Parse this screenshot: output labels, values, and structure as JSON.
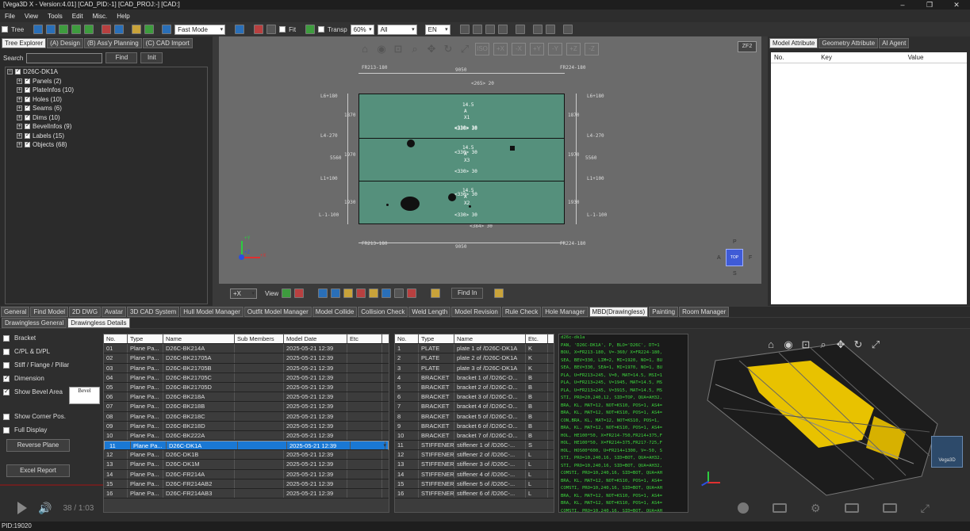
{
  "title_bar": {
    "text": "[Vega3D X - Version:4.01] [CAD_PID:-1] [CAD_PROJ:-] [CAD:]",
    "minimize": "–",
    "maximize": "❐",
    "close": "✕"
  },
  "menu": [
    "File",
    "View",
    "Tools",
    "Edit",
    "Misc.",
    "Help"
  ],
  "toolbar": {
    "tree_label": "Tree",
    "mode": "Fast Mode",
    "fit_label": "Fit",
    "transp_label": "Transp",
    "transp_value": "60%",
    "filter_value": "All",
    "lang_value": "EN"
  },
  "left_panel": {
    "tabs": [
      "Tree Explorer",
      "(A) Design",
      "(B) Ass'y Planning",
      "(C) CAD Import"
    ],
    "search_label": "Search",
    "find_button": "Find",
    "init_button": "Init",
    "root": "D26C-DK1A",
    "items": [
      "Panels (2)",
      "PlateInfos (10)",
      "Holes (10)",
      "Seams (6)",
      "Dims (10)",
      "BevelInfos (9)",
      "Labels (15)",
      "Objects (68)"
    ]
  },
  "viewport": {
    "ff_label": "ZF2",
    "view_buttons": [
      "ISO",
      "+X",
      "-X",
      "+Y",
      "-Y",
      "+Z",
      "-Z"
    ],
    "dims": {
      "top_width": "9050",
      "bottom_width": "9050",
      "left_total": "5560",
      "right_total": "5560",
      "left_upper": "1870",
      "left_middle": "1970",
      "left_lower": "1930",
      "right_upper": "1870",
      "right_middle": "1970",
      "right_lower": "1930",
      "top_inner": "<265> 20",
      "bottom_inner": "<384> 30"
    },
    "frame_labels": {
      "top_left": "FR213-180",
      "top_right": "FR224-180",
      "bottom_left": "FR213-180",
      "bottom_right": "FR224-180",
      "left": [
        "L6+180",
        "L4-270",
        "L1+100",
        "L-1-100"
      ],
      "right": [
        "L6+180",
        "L4-270",
        "L1+100",
        "L-1-100"
      ]
    },
    "plate_labels": [
      {
        "t": "14.5",
        "a": "A",
        "k": "X1",
        "s": "<330> 30"
      },
      {
        "t": "14.5",
        "a": "A",
        "k": "X3",
        "s": "<330> 30"
      },
      {
        "t": "14.5",
        "a": "A",
        "k": "X2",
        "s": "<330> 30"
      }
    ],
    "row_spacing": [
      "<330> 30",
      "<330> 30",
      "<330> 30"
    ],
    "axis": {
      "y": "+Y",
      "x": "+X",
      "z": "+Z"
    },
    "cube": {
      "top": "P",
      "left": "A",
      "right": "F",
      "bottom": "S",
      "face": "TOP"
    },
    "bottom_view_value": "+X",
    "view_label": "View",
    "find_in": "Find In"
  },
  "right_panel": {
    "tabs": [
      "Model Attribute",
      "Geometry Attribute",
      "AI Agent"
    ],
    "columns": [
      "No.",
      "Key",
      "Value"
    ]
  },
  "bottom_tabs": [
    "General",
    "Find Model",
    "2D DWG",
    "Avatar",
    "3D CAD System",
    "Hull Model Manager",
    "Outfit Model Manager",
    "Model Collide",
    "Collision Check",
    "Weld Length",
    "Model Revision",
    "Rule Check",
    "Hole Manager",
    "MBD(Drawingless)",
    "Painting",
    "Room Manager"
  ],
  "sub_tabs": [
    "Drawingless General",
    "Drawingless Details"
  ],
  "options": [
    {
      "label": "Bracket",
      "checked": false
    },
    {
      "label": "C/PL & D/PL",
      "checked": false
    },
    {
      "label": "Stiff / Flange / Pillar",
      "checked": false
    },
    {
      "label": "Dimension",
      "checked": true
    },
    {
      "label": "Show Bevel Area",
      "checked": true
    },
    {
      "label": "Show Corner Pos.",
      "checked": false
    },
    {
      "label": "Full Display",
      "checked": false
    }
  ],
  "bevel_label": "Bevel",
  "reverse_plane": "Reverse Plane",
  "excel_report": "Excel Report",
  "player_time": "38 / 1:03",
  "left_grid": {
    "columns": [
      "No.",
      "Type",
      "Name",
      "Sub Members",
      "Model Date",
      "Etc"
    ],
    "rows": [
      [
        "01",
        "Plane Pa...",
        "D26C-BK214A",
        "",
        "2025-05-21 12:39",
        ""
      ],
      [
        "02",
        "Plane Pa...",
        "D26C-BK21705A",
        "",
        "2025-05-21 12:39",
        ""
      ],
      [
        "03",
        "Plane Pa...",
        "D26C-BK21705B",
        "",
        "2025-05-21 12:39",
        ""
      ],
      [
        "04",
        "Plane Pa...",
        "D26C-BK21705C",
        "",
        "2025-05-21 12:39",
        ""
      ],
      [
        "05",
        "Plane Pa...",
        "D26C-BK21705D",
        "",
        "2025-05-21 12:39",
        ""
      ],
      [
        "06",
        "Plane Pa...",
        "D26C-BK218A",
        "",
        "2025-05-21 12:39",
        ""
      ],
      [
        "07",
        "Plane Pa...",
        "D26C-BK218B",
        "",
        "2025-05-21 12:39",
        ""
      ],
      [
        "08",
        "Plane Pa...",
        "D26C-BK218C",
        "",
        "2025-05-21 12:39",
        ""
      ],
      [
        "09",
        "Plane Pa...",
        "D26C-BK218D",
        "",
        "2025-05-21 12:39",
        ""
      ],
      [
        "10",
        "Plane Pa...",
        "D26C-BK222A",
        "",
        "2025-05-21 12:39",
        ""
      ],
      [
        "11",
        "Plane Pa...",
        "D26C-DK1A",
        "",
        "2025-05-21 12:39",
        ""
      ],
      [
        "12",
        "Plane Pa...",
        "D26C-DK1B",
        "",
        "2025-05-21 12:39",
        ""
      ],
      [
        "13",
        "Plane Pa...",
        "D26C-DK1M",
        "",
        "2025-05-21 12:39",
        ""
      ],
      [
        "14",
        "Plane Pa...",
        "D26C-FR214A",
        "",
        "2025-05-21 12:39",
        ""
      ],
      [
        "15",
        "Plane Pa...",
        "D26C-FR214AB2",
        "",
        "2025-05-21 12:39",
        ""
      ],
      [
        "16",
        "Plane Pa...",
        "D26C-FR214AB3",
        "",
        "2025-05-21 12:39",
        ""
      ]
    ],
    "selected": 10
  },
  "right_grid": {
    "columns": [
      "No.",
      "Type",
      "Name",
      "Etc."
    ],
    "rows": [
      [
        "1",
        "PLATE",
        "plate 1 of /D26C-DK1A",
        "K"
      ],
      [
        "2",
        "PLATE",
        "plate 2 of /D26C-DK1A",
        "K"
      ],
      [
        "3",
        "PLATE",
        "plate 3 of /D26C-DK1A",
        "K"
      ],
      [
        "4",
        "BRACKET",
        "bracket 1 of /D26C-D...",
        "B"
      ],
      [
        "5",
        "BRACKET",
        "bracket 2 of /D26C-D...",
        "B"
      ],
      [
        "6",
        "BRACKET",
        "bracket 3 of /D26C-D...",
        "B"
      ],
      [
        "7",
        "BRACKET",
        "bracket 4 of /D26C-D...",
        "B"
      ],
      [
        "8",
        "BRACKET",
        "bracket 5 of /D26C-D...",
        "B"
      ],
      [
        "9",
        "BRACKET",
        "bracket 6 of /D26C-D...",
        "B"
      ],
      [
        "10",
        "BRACKET",
        "bracket 7 of /D26C-D...",
        "B"
      ],
      [
        "11",
        "STIFFENER",
        "stiffener 1 of /D26C-...",
        "S"
      ],
      [
        "12",
        "STIFFENER",
        "stiffener 2 of /D26C-...",
        "L"
      ],
      [
        "13",
        "STIFFENER",
        "stiffener 3 of /D26C-...",
        "L"
      ],
      [
        "14",
        "STIFFENER",
        "stiffener 4 of /D26C-...",
        "L"
      ],
      [
        "15",
        "STIFFENER",
        "stiffener 5 of /D26C-...",
        "L"
      ],
      [
        "16",
        "STIFFENER",
        "stiffener 6 of /D26C-...",
        "L"
      ]
    ]
  },
  "text_panel": [
    "d26c-dk1a",
    "PAN, 'D26C-DK1A', P, BLO='D26C', DT=1",
    "BOU, X=FR213-180, V=-360/ X=FR224-180,",
    "SEA, BEV=330, LIM=2, MI=1920, NO=1, BU",
    "SEA, BEV=330, SEA=1, MI=1970, NO=1, BU",
    "PLA, U=FR213+245, V=0, MAT=14.5, MSI=1",
    "PLA, U=FR213+245, V=1945, MAT=14.5, MS",
    "PLA, U=FR213+245, V=3915, MAT=14.5, MS",
    "STI, PRO=20,240,12, SID=TOP, QUA=AH32,",
    "BRA, KL, MAT=12, NOT=KS10, POS=1, AS4=",
    "BRA, KL, MAT=12, NOT=KS10, POS=1, AS4=",
    "CON,BRA, KL, MAT=12, NOT=KS10, POS=1,",
    "BRA, KL, MAT=12, NOT=KS10, POS=1, AS4=",
    "HOL, HE100*50, X=FR214-750,FR214+375,F",
    "HOL, HE100*50, X=FR214+375,FR217-725,F",
    "HOL, HOS00*600, U=FR214+1300, V=-50, S",
    "STI, PRO=10,240,16, SID=BOT, QUA=AH32,",
    "STI, PRO=10,240,16, SID=BOT, QUA=AH32,",
    "COMSTI, PRO=10,240,16, SID=BOT, QUA=AH",
    "BRA, KL, MAT=12, NOT=KS10, POS=1, AS4=",
    "COMSTI, PRO=10,240,16, SID=BOT, QUA=AH",
    "BRA, KL, MAT=12, NOT=KS10, POS=1, AS4=",
    "BRA, KL, MAT=12, NOT=KS10, POS=1, AS4=",
    "COMSTI, PRO=10,240,16, SID=BOT, QUA=AH"
  ],
  "preview_badge": "Vega3D",
  "status": "PID:19020"
}
